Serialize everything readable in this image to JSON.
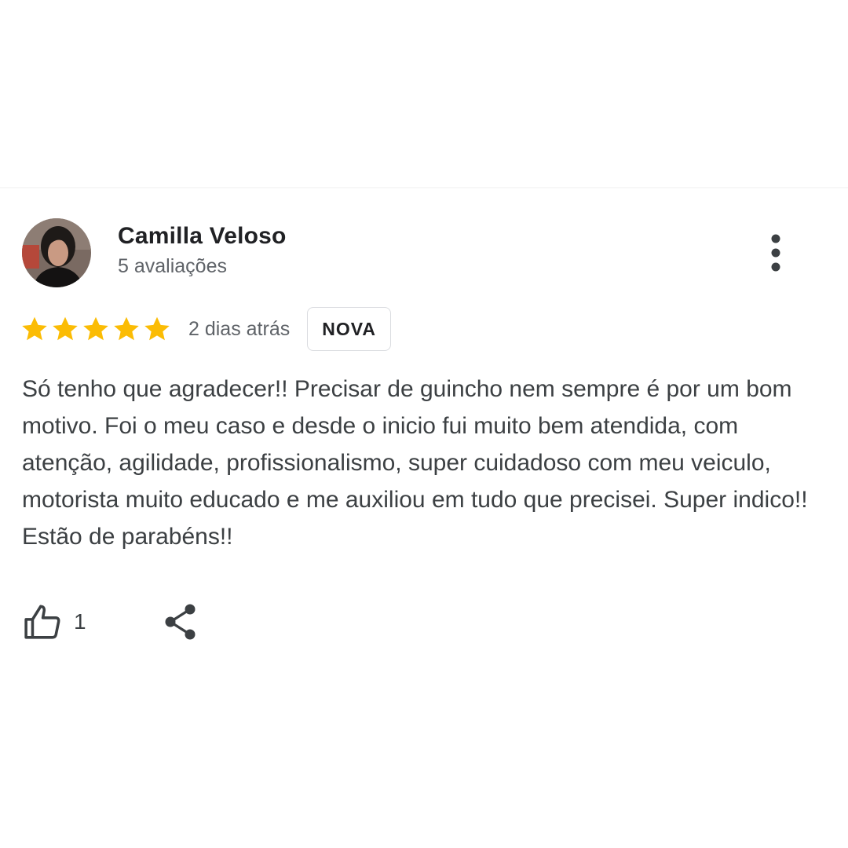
{
  "review": {
    "reviewer": {
      "name": "Camilla Veloso",
      "review_count": "5 avaliações"
    },
    "rating": {
      "stars": 5,
      "max": 5,
      "color": "#fbbc04"
    },
    "date": "2 dias atrás",
    "badge": "NOVA",
    "text": "Só tenho que agradecer!! Precisar de guincho nem sempre é por um bom motivo. Foi o meu caso e desde o inicio fui muito bem atendida, com atenção, agilidade, profissionalismo, super cuidadoso com meu veiculo, motorista muito educado e me auxiliou em tudo que precisei. Super indico!! Estão de parabéns!!",
    "likes": "1",
    "icons": {
      "more": "more-vert-icon",
      "like": "thumb-up-icon",
      "share": "share-icon"
    }
  }
}
